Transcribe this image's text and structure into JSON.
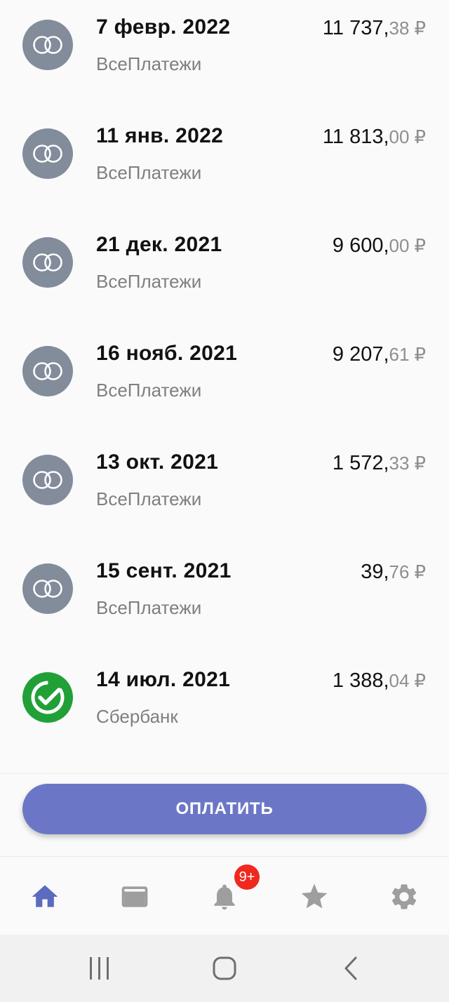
{
  "payments": [
    {
      "date": "7 февр. 2022",
      "provider": "ВсеПлатежи",
      "amount_int": "11 737,",
      "amount_frac": "38",
      "currency": "₽",
      "icon": "payment-system-icon"
    },
    {
      "date": "11 янв. 2022",
      "provider": "ВсеПлатежи",
      "amount_int": "11 813,",
      "amount_frac": "00",
      "currency": "₽",
      "icon": "payment-system-icon"
    },
    {
      "date": "21 дек. 2021",
      "provider": "ВсеПлатежи",
      "amount_int": "9 600,",
      "amount_frac": "00",
      "currency": "₽",
      "icon": "payment-system-icon"
    },
    {
      "date": "16 нояб. 2021",
      "provider": "ВсеПлатежи",
      "amount_int": "9 207,",
      "amount_frac": "61",
      "currency": "₽",
      "icon": "payment-system-icon"
    },
    {
      "date": "13 окт. 2021",
      "provider": "ВсеПлатежи",
      "amount_int": "1 572,",
      "amount_frac": "33",
      "currency": "₽",
      "icon": "payment-system-icon"
    },
    {
      "date": "15 сент. 2021",
      "provider": "ВсеПлатежи",
      "amount_int": "39,",
      "amount_frac": "76",
      "currency": "₽",
      "icon": "payment-system-icon"
    },
    {
      "date": "14 июл. 2021",
      "provider": "Сбербанк",
      "amount_int": "1 388,",
      "amount_frac": "04",
      "currency": "₽",
      "icon": "sberbank-logo-icon"
    }
  ],
  "pay_button": {
    "label": "ОПЛАТИТЬ"
  },
  "nav": {
    "items": [
      {
        "icon": "home-icon",
        "active": true
      },
      {
        "icon": "card-icon",
        "active": false
      },
      {
        "icon": "bell-icon",
        "active": false
      },
      {
        "icon": "star-icon",
        "active": false
      },
      {
        "icon": "gear-icon",
        "active": false
      }
    ],
    "notifications_badge": "9+"
  },
  "colors": {
    "accent": "#6b77c6",
    "nav_active": "#5c6bc0",
    "nav_inactive": "#9e9e9e",
    "badge": "#f0281e",
    "provider_icon_bg": "#838c9b",
    "sberbank_green": "#21a038"
  }
}
